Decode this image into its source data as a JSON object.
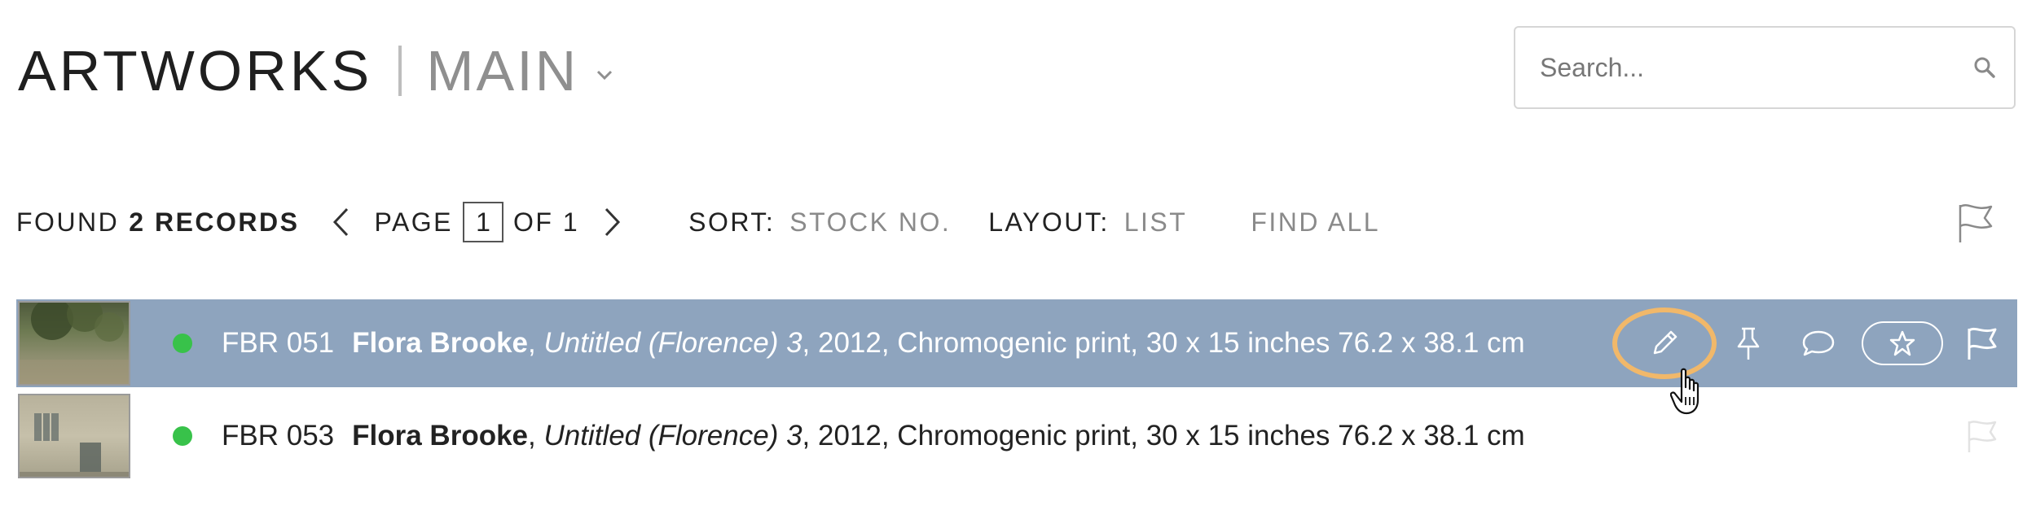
{
  "header": {
    "title": "ARTWORKS",
    "subtitle": "MAIN"
  },
  "search": {
    "placeholder": "Search..."
  },
  "toolbar": {
    "found_prefix": "FOUND",
    "found_count": "2 RECORDS",
    "page_label": "PAGE",
    "page_value": "1",
    "of_label": "OF 1",
    "sort_label": "SORT:",
    "sort_value": "STOCK NO.",
    "layout_label": "LAYOUT:",
    "layout_value": "LIST",
    "find_all": "FIND ALL"
  },
  "records": [
    {
      "stock_no": "FBR 051",
      "artist": "Flora Brooke",
      "title": "Untitled (Florence) 3",
      "details": ", 2012, Chromogenic print, 30 x 15 inches 76.2 x 38.1 cm",
      "status_color": "#38c24a",
      "selected": true
    },
    {
      "stock_no": "FBR 053",
      "artist": "Flora Brooke",
      "title": "Untitled (Florence) 3",
      "details": ", 2012, Chromogenic print, 30 x 15 inches 76.2 x 38.1 cm",
      "status_color": "#38c24a",
      "selected": false
    }
  ],
  "icons": {
    "row_actions": [
      "pencil-icon",
      "pin-icon",
      "comment-icon",
      "star-icon",
      "flag-icon"
    ]
  },
  "colors": {
    "selected_row": "#8ea4be",
    "status_dot": "#38c24a",
    "edit_highlight": "#f1b86a"
  }
}
